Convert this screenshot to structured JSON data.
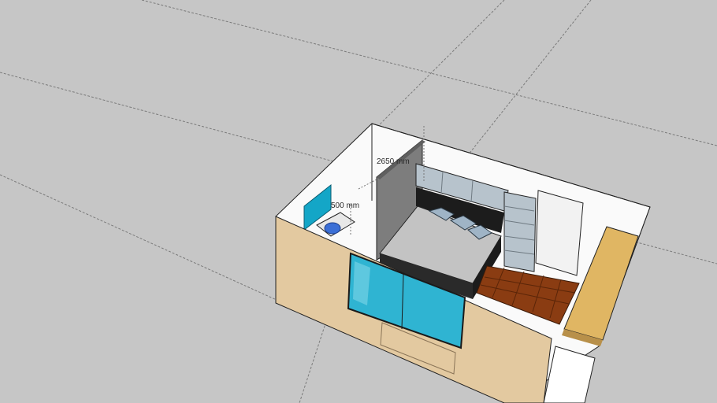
{
  "viewport": {
    "background_color": "#c6c6c6",
    "ground_line_color": "#7a7a7a"
  },
  "model": {
    "wall_wood_color": "#e3c9a0",
    "floor_color": "#ffffff",
    "partition_color": "#7d7d7d",
    "cabinet_color": "#b7c3cc",
    "bed_color": "#c3c3c3",
    "pillow_color": "#9fb4c6",
    "deck_color": "#8a3c12",
    "cork_color": "#e0b663",
    "glass_color": "#2fb4d2",
    "blue_panel_color": "#14a6c7"
  },
  "dimensions": {
    "height_label": "2650 mm",
    "width_label": "500 mm"
  }
}
